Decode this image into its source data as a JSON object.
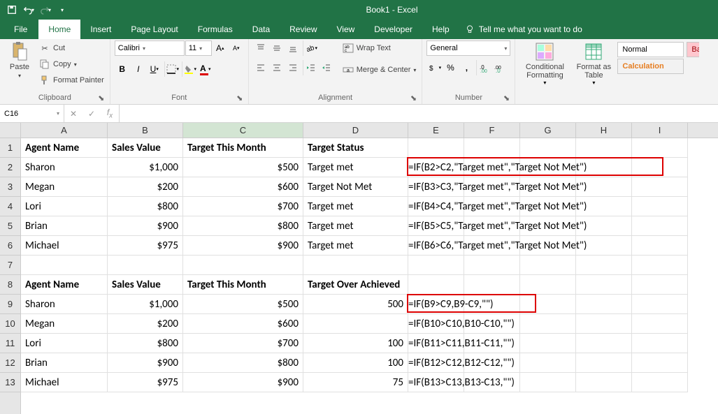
{
  "title": "Book1 - Excel",
  "tabs": {
    "file": "File",
    "home": "Home",
    "insert": "Insert",
    "pageLayout": "Page Layout",
    "formulas": "Formulas",
    "data": "Data",
    "review": "Review",
    "view": "View",
    "developer": "Developer",
    "help": "Help",
    "tellme": "Tell me what you want to do"
  },
  "ribbon": {
    "clipboard": {
      "label": "Clipboard",
      "paste": "Paste",
      "cut": "Cut",
      "copy": "Copy",
      "painter": "Format Painter"
    },
    "font": {
      "label": "Font",
      "name": "Calibri",
      "size": "11"
    },
    "alignment": {
      "label": "Alignment",
      "wrap": "Wrap Text",
      "merge": "Merge & Center"
    },
    "number": {
      "label": "Number",
      "format": "General"
    },
    "styles": {
      "cond": "Conditional Formatting",
      "table": "Format as Table",
      "normal": "Normal",
      "calc": "Calculation",
      "bad": "Ba"
    }
  },
  "namebox": "C16",
  "formulabar": "",
  "cols": [
    "A",
    "B",
    "C",
    "D",
    "E",
    "F",
    "G",
    "H",
    "I"
  ],
  "rows": [
    "1",
    "2",
    "3",
    "4",
    "5",
    "6",
    "7",
    "8",
    "9",
    "10",
    "11",
    "12",
    "13"
  ],
  "data": {
    "h1": {
      "A": "Agent Name",
      "B": "Sales Value",
      "C": "Target This Month",
      "D": "Target Status"
    },
    "r2": {
      "A": "Sharon",
      "B": "$1,000",
      "C": "$500",
      "D": "Target met",
      "E": "=IF(B2>C2,\"Target met\",\"Target Not Met\")"
    },
    "r3": {
      "A": "Megan",
      "B": "$200",
      "C": "$600",
      "D": "Target Not Met",
      "E": "=IF(B3>C3,\"Target met\",\"Target Not Met\")"
    },
    "r4": {
      "A": "Lori",
      "B": "$800",
      "C": "$700",
      "D": "Target met",
      "E": "=IF(B4>C4,\"Target met\",\"Target Not Met\")"
    },
    "r5": {
      "A": "Brian",
      "B": "$900",
      "C": "$800",
      "D": "Target met",
      "E": "=IF(B5>C5,\"Target met\",\"Target Not Met\")"
    },
    "r6": {
      "A": "Michael",
      "B": "$975",
      "C": "$900",
      "D": "Target met",
      "E": "=IF(B6>C6,\"Target met\",\"Target Not Met\")"
    },
    "h8": {
      "A": "Agent Name",
      "B": "Sales Value",
      "C": "Target This Month",
      "D": "Target Over Achieved"
    },
    "r9": {
      "A": "Sharon",
      "B": "$1,000",
      "C": "$500",
      "D": "500",
      "E": "=IF(B9>C9,B9-C9,\"\")"
    },
    "r10": {
      "A": "Megan",
      "B": "$200",
      "C": "$600",
      "D": "",
      "E": "=IF(B10>C10,B10-C10,\"\")"
    },
    "r11": {
      "A": "Lori",
      "B": "$800",
      "C": "$700",
      "D": "100",
      "E": "=IF(B11>C11,B11-C11,\"\")"
    },
    "r12": {
      "A": "Brian",
      "B": "$900",
      "C": "$800",
      "D": "100",
      "E": "=IF(B12>C12,B12-C12,\"\")"
    },
    "r13": {
      "A": "Michael",
      "B": "$975",
      "C": "$900",
      "D": "75",
      "E": "=IF(B13>C13,B13-C13,\"\")"
    }
  }
}
